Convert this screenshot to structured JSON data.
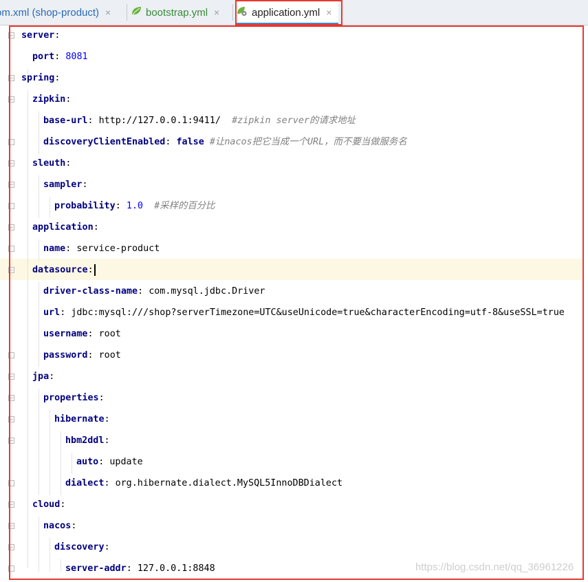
{
  "tabs": [
    {
      "label": "om.xml (shop-product)",
      "icon": "maven-xml-icon",
      "active": false
    },
    {
      "label": "bootstrap.yml",
      "icon": "spring-leaf-icon",
      "active": false
    },
    {
      "label": "application.yml",
      "icon": "spring-gear-icon",
      "active": true
    }
  ],
  "close_glyph": "×",
  "colors": {
    "highlight_box": "#e8372f",
    "key": "#000080",
    "number": "#0000ff",
    "comment": "#808080",
    "caret_line": "#fcf8e3"
  },
  "code": {
    "l1": {
      "key": "server"
    },
    "l2": {
      "key": "port",
      "value": "8081"
    },
    "l3": {
      "key": "spring"
    },
    "l4": {
      "key": "zipkin"
    },
    "l5": {
      "key": "base-url",
      "value": "http://127.0.0.1:9411/",
      "comment": "#zipkin server的请求地址"
    },
    "l6": {
      "key": "discoveryClientEnabled",
      "value": "false",
      "comment": "#让nacos把它当成一个URL，而不要当做服务名"
    },
    "l7": {
      "key": "sleuth"
    },
    "l8": {
      "key": "sampler"
    },
    "l9": {
      "key": "probability",
      "value": "1.0",
      "comment": "#采样的百分比"
    },
    "l10": {
      "key": "application"
    },
    "l11": {
      "key": "name",
      "value": "service-product"
    },
    "l12": {
      "key": "datasource"
    },
    "l13": {
      "key": "driver-class-name",
      "value": "com.mysql.jdbc.Driver"
    },
    "l14": {
      "key": "url",
      "value": "jdbc:mysql:///shop?serverTimezone=UTC&useUnicode=true&characterEncoding=utf-8&useSSL=true"
    },
    "l15": {
      "key": "username",
      "value": "root"
    },
    "l16": {
      "key": "password",
      "value": "root"
    },
    "l17": {
      "key": "jpa"
    },
    "l18": {
      "key": "properties"
    },
    "l19": {
      "key": "hibernate"
    },
    "l20": {
      "key": "hbm2ddl"
    },
    "l21": {
      "key": "auto",
      "value": "update"
    },
    "l22": {
      "key": "dialect",
      "value": "org.hibernate.dialect.MySQL5InnoDBDialect"
    },
    "l23": {
      "key": "cloud"
    },
    "l24": {
      "key": "nacos"
    },
    "l25": {
      "key": "discovery"
    },
    "l26": {
      "key": "server-addr",
      "value": "127.0.0.1:8848"
    }
  },
  "watermark": "https://blog.csdn.net/qq_36961226"
}
